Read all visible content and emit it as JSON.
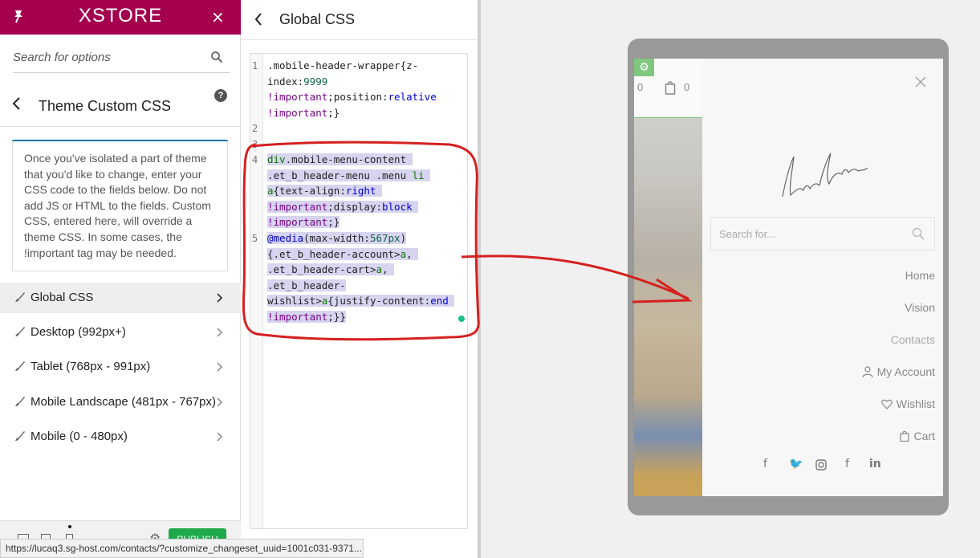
{
  "brand": {
    "logo": "XSTORE",
    "close": "×"
  },
  "search": {
    "placeholder": "Search for options"
  },
  "section": {
    "title": "Theme Custom CSS",
    "help": "?"
  },
  "description": "Once you've isolated a part of theme that you'd like to change, enter your CSS code to the fields below. Do not add JS or HTML to the fields. Custom CSS, entered here, will override a theme CSS. In some cases, the !important tag may be needed.",
  "menu": [
    {
      "label": "Global CSS",
      "active": true
    },
    {
      "label": "Desktop (992px+)"
    },
    {
      "label": "Tablet (768px - 991px)"
    },
    {
      "label": "Mobile Landscape (481px - 767px)"
    },
    {
      "label": "Mobile (0 - 480px)"
    }
  ],
  "footer": {
    "publish": "PUBLISH"
  },
  "editor": {
    "title": "Global CSS",
    "line_numbers": [
      "1",
      "2",
      "3",
      "4",
      "5"
    ]
  },
  "preview": {
    "search_placeholder": "Search for...",
    "mini_counts": [
      "0",
      "0"
    ],
    "nav": [
      "Home",
      "Vision",
      "Contacts",
      "My Account",
      "Wishlist",
      "Cart"
    ],
    "social_icons": [
      "facebook-icon",
      "twitter-icon",
      "instagram-icon",
      "facebook-icon",
      "linkedin-icon"
    ]
  },
  "status_url": "https://lucaq3.sg-host.com/contacts/?customize_changeset_uuid=1001c031-9371...",
  "colors": {
    "brand": "#a4004e",
    "publish": "#1eaa4b",
    "selection": "#d7d4f0",
    "annotation": "#d62020"
  }
}
